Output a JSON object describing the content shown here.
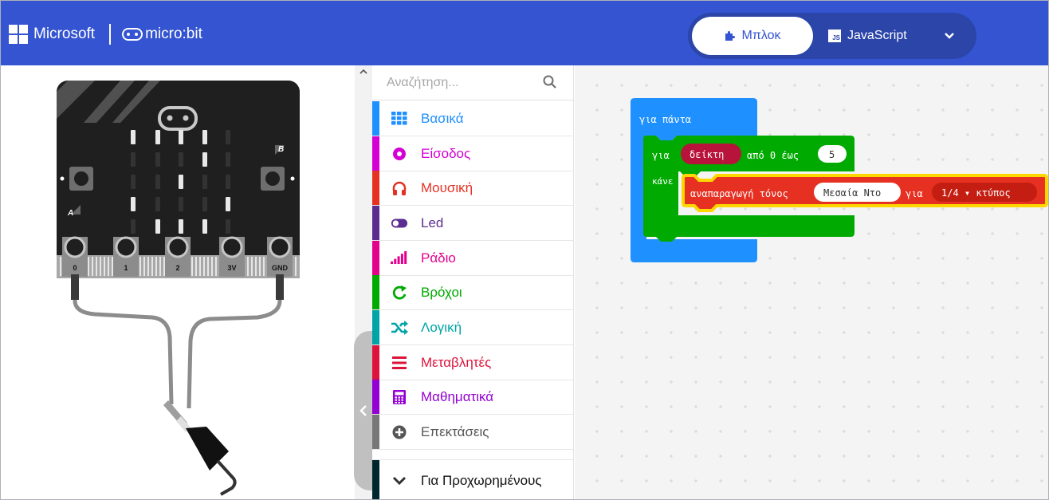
{
  "header": {
    "microsoft_label": "Microsoft",
    "microbit_label": "micro:bit",
    "blocks_label": "Μπλοκ",
    "javascript_label": "JavaScript",
    "js_badge": "JS"
  },
  "simulator": {
    "pins": [
      "0",
      "1",
      "2",
      "3V",
      "GND"
    ],
    "button_a": "A",
    "button_b": "B"
  },
  "toolbox": {
    "search_placeholder": "Αναζήτηση...",
    "categories": [
      {
        "label": "Βασικά",
        "color": "#1e90ff",
        "icon": "grid-icon"
      },
      {
        "label": "Είσοδος",
        "color": "#d400d4",
        "icon": "input-dot-icon"
      },
      {
        "label": "Μουσική",
        "color": "#e63022",
        "icon": "headphones-icon"
      },
      {
        "label": "Led",
        "color": "#5c2d91",
        "icon": "toggle-icon"
      },
      {
        "label": "Ράδιο",
        "color": "#e3008c",
        "icon": "signal-bars-icon"
      },
      {
        "label": "Βρόχοι",
        "color": "#00aa00",
        "icon": "loop-arrow-icon"
      },
      {
        "label": "Λογική",
        "color": "#00a4a6",
        "icon": "shuffle-icon"
      },
      {
        "label": "Μεταβλητές",
        "color": "#dc143c",
        "icon": "lines-icon"
      },
      {
        "label": "Μαθηματικά",
        "color": "#9400d3",
        "icon": "calculator-icon"
      },
      {
        "label": "Επεκτάσεις",
        "color": "#777777",
        "icon": "plus-circle-icon"
      },
      {
        "label": "Για Προχωρημένους",
        "color": "#00272b",
        "icon": "chevron-down-icon"
      }
    ]
  },
  "blocks": {
    "forever_label": "για πάντα",
    "for_label": "για",
    "index_var": "δείκτη",
    "from_label": "από 0 έως",
    "to_value": "5",
    "do_label": "κάνε",
    "play_tone_label": "αναπαραγωγή τόνος",
    "note_value": "Μεσαία Ντο",
    "for_duration_label": "για",
    "beat_value": "1/4 ▾ κτύπος"
  },
  "colors": {
    "header": "#3454d1",
    "forever_block": "#1e90ff",
    "loop_block": "#00aa00",
    "music_block": "#e63022",
    "variable_block": "#b8133a",
    "selection_outline": "#ffd700"
  }
}
